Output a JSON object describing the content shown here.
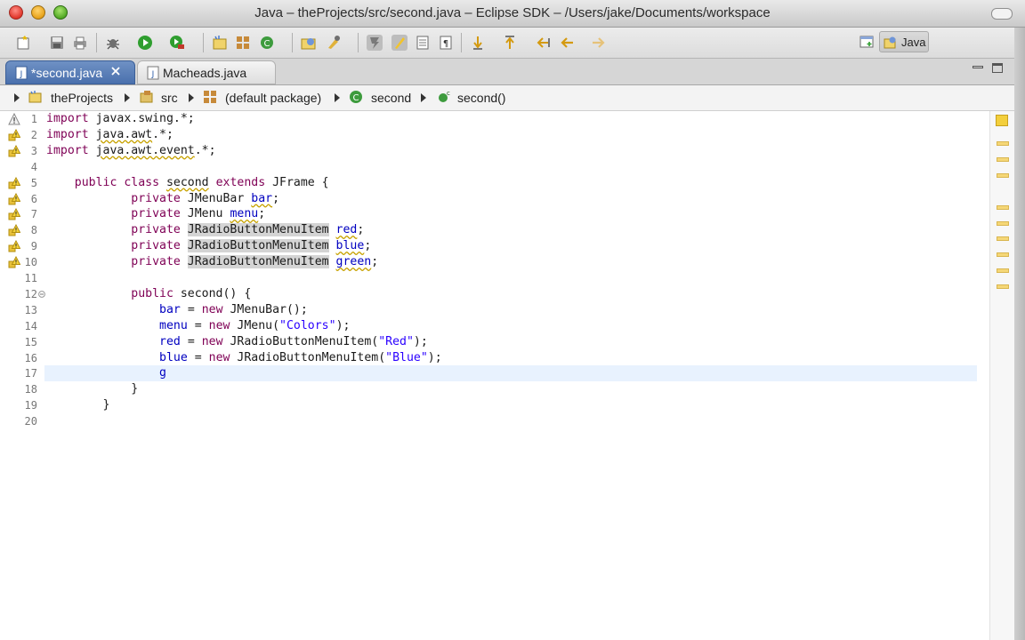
{
  "window": {
    "title": "Java – theProjects/src/second.java – Eclipse SDK – /Users/jake/Documents/workspace"
  },
  "toolbar": {
    "icons": [
      "new-wizard-icon",
      "save-icon",
      "print-icon",
      "debug-icon",
      "run-icon",
      "external-tools-icon",
      "new-java-project-icon",
      "new-package-icon",
      "new-class-icon",
      "open-type-icon",
      "search-icon",
      "toggle-mark-occurrences-icon",
      "highlight-icon",
      "show-whitespace-icon",
      "paragraph-icon",
      "next-annotation-icon",
      "previous-annotation-icon",
      "last-edit-location-icon",
      "back-icon",
      "forward-icon"
    ],
    "perspective_label": "Java"
  },
  "tabs": [
    {
      "label": "*second.java",
      "active": true
    },
    {
      "label": "Macheads.java",
      "active": false
    }
  ],
  "breadcrumb": [
    "theProjects",
    "src",
    "(default package)",
    "second",
    "second()"
  ],
  "editor": {
    "current_line": 17,
    "lines": [
      {
        "n": "1",
        "marker": "info",
        "fold": false,
        "tokens": [
          {
            "t": "import ",
            "c": "kw"
          },
          {
            "t": "javax.swing.*;"
          }
        ]
      },
      {
        "n": "2",
        "marker": "warning",
        "fold": false,
        "tokens": [
          {
            "t": "import ",
            "c": "kw"
          },
          {
            "t": "java.awt",
            "c": "warn"
          },
          {
            "t": ".*;"
          }
        ]
      },
      {
        "n": "3",
        "marker": "warning",
        "fold": false,
        "tokens": [
          {
            "t": "import ",
            "c": "kw"
          },
          {
            "t": "java.awt.event",
            "c": "warn"
          },
          {
            "t": ".*;"
          }
        ]
      },
      {
        "n": "4",
        "marker": "",
        "fold": false,
        "tokens": []
      },
      {
        "n": "5",
        "marker": "warning",
        "fold": false,
        "tokens": [
          {
            "t": "    public class ",
            "c": "kw"
          },
          {
            "t": "second",
            "c": "warn"
          },
          {
            "t": " "
          },
          {
            "t": "extends ",
            "c": "kw"
          },
          {
            "t": "JFrame {"
          }
        ]
      },
      {
        "n": "6",
        "marker": "warning",
        "fold": false,
        "tokens": [
          {
            "t": "            private ",
            "c": "kw"
          },
          {
            "t": "JMenuBar "
          },
          {
            "t": "bar",
            "c": "fld warn"
          },
          {
            "t": ";"
          }
        ]
      },
      {
        "n": "7",
        "marker": "warning",
        "fold": false,
        "tokens": [
          {
            "t": "            private ",
            "c": "kw"
          },
          {
            "t": "JMenu "
          },
          {
            "t": "menu",
            "c": "fld warn"
          },
          {
            "t": ";"
          }
        ]
      },
      {
        "n": "8",
        "marker": "warning",
        "fold": false,
        "tokens": [
          {
            "t": "            private ",
            "c": "kw"
          },
          {
            "t": "JRadioButtonMenuItem",
            "c": "hl"
          },
          {
            "t": " "
          },
          {
            "t": "red",
            "c": "fld warn"
          },
          {
            "t": ";"
          }
        ]
      },
      {
        "n": "9",
        "marker": "warning",
        "fold": false,
        "tokens": [
          {
            "t": "            private ",
            "c": "kw"
          },
          {
            "t": "JRadioButtonMenuItem",
            "c": "hl"
          },
          {
            "t": " "
          },
          {
            "t": "blue",
            "c": "fld warn"
          },
          {
            "t": ";"
          }
        ]
      },
      {
        "n": "10",
        "marker": "warning",
        "fold": false,
        "tokens": [
          {
            "t": "            private ",
            "c": "kw"
          },
          {
            "t": "JRadioButtonMenuItem",
            "c": "hl"
          },
          {
            "t": " "
          },
          {
            "t": "green",
            "c": "fld warn"
          },
          {
            "t": ";"
          }
        ]
      },
      {
        "n": "11",
        "marker": "",
        "fold": false,
        "tokens": []
      },
      {
        "n": "12",
        "marker": "",
        "fold": true,
        "tokens": [
          {
            "t": "            public ",
            "c": "kw"
          },
          {
            "t": "second() {"
          }
        ]
      },
      {
        "n": "13",
        "marker": "",
        "fold": false,
        "tokens": [
          {
            "t": "                "
          },
          {
            "t": "bar",
            "c": "fld"
          },
          {
            "t": " = "
          },
          {
            "t": "new ",
            "c": "kw"
          },
          {
            "t": "JMenuBar();"
          }
        ]
      },
      {
        "n": "14",
        "marker": "",
        "fold": false,
        "tokens": [
          {
            "t": "                "
          },
          {
            "t": "menu",
            "c": "fld"
          },
          {
            "t": " = "
          },
          {
            "t": "new ",
            "c": "kw"
          },
          {
            "t": "JMenu("
          },
          {
            "t": "\"Colors\"",
            "c": "str"
          },
          {
            "t": ");"
          }
        ]
      },
      {
        "n": "15",
        "marker": "",
        "fold": false,
        "tokens": [
          {
            "t": "                "
          },
          {
            "t": "red",
            "c": "fld"
          },
          {
            "t": " = "
          },
          {
            "t": "new ",
            "c": "kw"
          },
          {
            "t": "JRadioButtonMenuItem("
          },
          {
            "t": "\"Red\"",
            "c": "str"
          },
          {
            "t": ");"
          }
        ]
      },
      {
        "n": "16",
        "marker": "",
        "fold": false,
        "tokens": [
          {
            "t": "                "
          },
          {
            "t": "blue",
            "c": "fld"
          },
          {
            "t": " = "
          },
          {
            "t": "new ",
            "c": "kw"
          },
          {
            "t": "JRadioButtonMenuItem("
          },
          {
            "t": "\"Blue\"",
            "c": "str"
          },
          {
            "t": ");"
          }
        ]
      },
      {
        "n": "17",
        "marker": "",
        "fold": false,
        "tokens": [
          {
            "t": "                "
          },
          {
            "t": "g",
            "c": "fld"
          }
        ]
      },
      {
        "n": "18",
        "marker": "",
        "fold": false,
        "tokens": [
          {
            "t": "            }"
          }
        ]
      },
      {
        "n": "19",
        "marker": "",
        "fold": false,
        "tokens": [
          {
            "t": "        }"
          }
        ]
      },
      {
        "n": "20",
        "marker": "",
        "fold": false,
        "tokens": []
      }
    ]
  },
  "colors": {
    "keyword": "#7f0055",
    "string": "#2a00ff",
    "field": "#0000c0",
    "active_tab": "#4a70ad",
    "current_line": "#e8f2fe"
  }
}
